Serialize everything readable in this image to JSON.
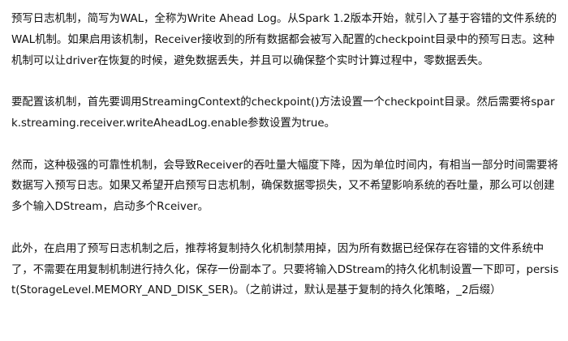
{
  "document": {
    "paragraphs": [
      "预写日志机制，简写为WAL，全称为Write Ahead Log。从Spark 1.2版本开始，就引入了基于容错的文件系统的WAL机制。如果启用该机制，Receiver接收到的所有数据都会被写入配置的checkpoint目录中的预写日志。这种机制可以让driver在恢复的时候，避免数据丢失，并且可以确保整个实时计算过程中，零数据丢失。",
      "要配置该机制，首先要调用StreamingContext的checkpoint()方法设置一个checkpoint目录。然后需要将spark.streaming.receiver.writeAheadLog.enable参数设置为true。",
      "然而，这种极强的可靠性机制，会导致Receiver的吞吐量大幅度下降，因为单位时间内，有相当一部分时间需要将数据写入预写日志。如果又希望开启预写日志机制，确保数据零损失，又不希望影响系统的吞吐量，那么可以创建多个输入DStream，启动多个Rceiver。",
      "此外，在启用了预写日志机制之后，推荐将复制持久化机制禁用掉，因为所有数据已经保存在容错的文件系统中了，不需要在用复制机制进行持久化，保存一份副本了。只要将输入DStream的持久化机制设置一下即可，persist(StorageLevel.MEMORY_AND_DISK_SER)。（之前讲过，默认是基于复制的持久化策略，_2后缀）"
    ]
  }
}
